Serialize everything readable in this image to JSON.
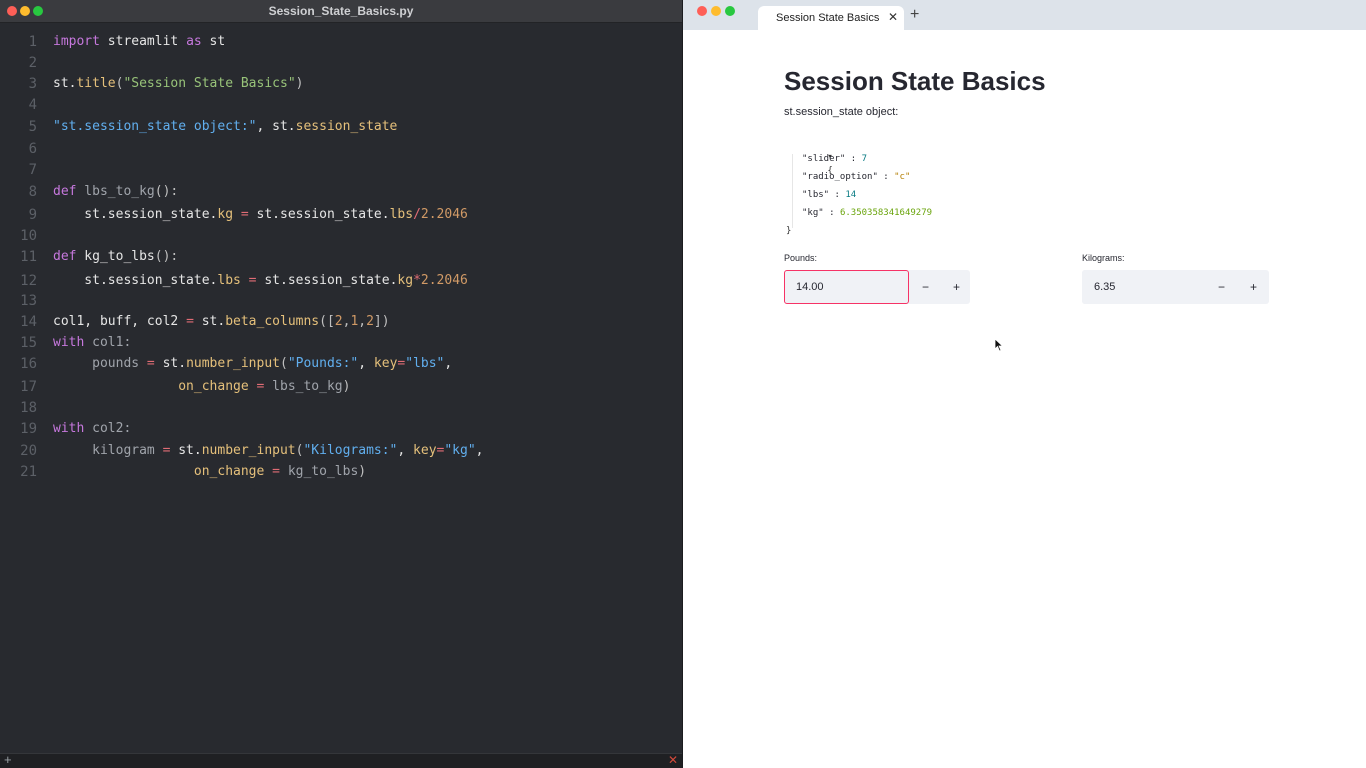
{
  "editor": {
    "title": "Session_State_Basics.py",
    "code": [
      {
        "n": "1",
        "tokens": [
          [
            "kw",
            "import"
          ],
          [
            "var",
            " streamlit "
          ],
          [
            "kw",
            "as"
          ],
          [
            "var",
            " st"
          ]
        ]
      },
      {
        "n": "2",
        "tokens": []
      },
      {
        "n": "3",
        "tokens": [
          [
            "var",
            "st."
          ],
          [
            "fn",
            "title"
          ],
          [
            "par",
            "("
          ],
          [
            "st",
            "\"Session State Basics\""
          ],
          [
            "par",
            ")"
          ]
        ]
      },
      {
        "n": "4",
        "tokens": []
      },
      {
        "n": "5",
        "tokens": [
          [
            "str2",
            "\"st.session_state object:\""
          ],
          [
            "var",
            ", st."
          ],
          [
            "fn",
            "session_state"
          ]
        ]
      },
      {
        "n": "6",
        "tokens": []
      },
      {
        "n": "7",
        "tokens": []
      },
      {
        "n": "8",
        "tokens": [
          [
            "kw",
            "def"
          ],
          [
            "dim",
            " lbs_to_kg"
          ],
          [
            "par",
            "():"
          ]
        ]
      },
      {
        "n": "9",
        "tokens": [
          [
            "var",
            "    st.session_state."
          ],
          [
            "fn",
            "kg"
          ],
          [
            "op",
            " = "
          ],
          [
            "var",
            "st.session_state."
          ],
          [
            "fn",
            "lbs"
          ],
          [
            "op",
            "/"
          ],
          [
            "num",
            "2.2046"
          ]
        ]
      },
      {
        "n": "10",
        "tokens": []
      },
      {
        "n": "11",
        "tokens": [
          [
            "kw",
            "def"
          ],
          [
            "var",
            " kg_to_lbs"
          ],
          [
            "par",
            "():"
          ]
        ]
      },
      {
        "n": "12",
        "tokens": [
          [
            "var",
            "    st.session_state."
          ],
          [
            "fn",
            "lbs"
          ],
          [
            "op",
            " = "
          ],
          [
            "var",
            "st.session_state."
          ],
          [
            "fn",
            "kg"
          ],
          [
            "op",
            "*"
          ],
          [
            "num",
            "2.2046"
          ]
        ]
      },
      {
        "n": "13",
        "tokens": []
      },
      {
        "n": "14",
        "tokens": [
          [
            "var",
            "col1, buff, col2 "
          ],
          [
            "op",
            "="
          ],
          [
            "var",
            " st."
          ],
          [
            "fn",
            "beta_columns"
          ],
          [
            "par",
            "(["
          ],
          [
            "num",
            "2"
          ],
          [
            "par",
            ","
          ],
          [
            "num",
            "1"
          ],
          [
            "par",
            ","
          ],
          [
            "num",
            "2"
          ],
          [
            "par",
            "])"
          ]
        ]
      },
      {
        "n": "15",
        "tokens": [
          [
            "kw",
            "with"
          ],
          [
            "dim",
            " col1:"
          ]
        ]
      },
      {
        "n": "16",
        "tokens": [
          [
            "dim",
            "     pounds "
          ],
          [
            "op",
            "="
          ],
          [
            "var",
            " st."
          ],
          [
            "fn",
            "number_input"
          ],
          [
            "par",
            "("
          ],
          [
            "str2",
            "\"Pounds:\""
          ],
          [
            "var",
            ", "
          ],
          [
            "fn",
            "key"
          ],
          [
            "op",
            "="
          ],
          [
            "str2",
            "\"lbs\""
          ],
          [
            "var",
            ","
          ]
        ]
      },
      {
        "n": "17",
        "tokens": [
          [
            "var",
            "                "
          ],
          [
            "fn",
            "on_change"
          ],
          [
            "op",
            " = "
          ],
          [
            "dim",
            "lbs_to_kg"
          ],
          [
            "par",
            ")"
          ]
        ]
      },
      {
        "n": "18",
        "tokens": []
      },
      {
        "n": "19",
        "tokens": [
          [
            "kw",
            "with"
          ],
          [
            "dim",
            " col2:"
          ]
        ]
      },
      {
        "n": "20",
        "tokens": [
          [
            "dim",
            "     kilogram "
          ],
          [
            "op",
            "="
          ],
          [
            "var",
            " st."
          ],
          [
            "fn",
            "number_input"
          ],
          [
            "par",
            "("
          ],
          [
            "str2",
            "\"Kilograms:\""
          ],
          [
            "var",
            ", "
          ],
          [
            "fn",
            "key"
          ],
          [
            "op",
            "="
          ],
          [
            "str2",
            "\"kg\""
          ],
          [
            "var",
            ","
          ]
        ]
      },
      {
        "n": "21",
        "tokens": [
          [
            "var",
            "                  "
          ],
          [
            "fn",
            "on_change"
          ],
          [
            "op",
            " = "
          ],
          [
            "dim",
            "kg_to_lbs"
          ],
          [
            "par",
            ")"
          ]
        ]
      }
    ],
    "status_plus": "+",
    "status_close": "✕"
  },
  "browser": {
    "tab_title": "Session State Basics",
    "tab_close": "✕",
    "new_tab": "+"
  },
  "app": {
    "title": "Session State Basics",
    "object_label": "st.session_state object:",
    "json": {
      "toggle": "▾",
      "open": "{",
      "close": "}",
      "entries": [
        {
          "key": "\"slider\"",
          "value": "7",
          "type": "jnum"
        },
        {
          "key": "\"radio_option\"",
          "value": "\"c\"",
          "type": "jstr"
        },
        {
          "key": "\"lbs\"",
          "value": "14",
          "type": "jnum"
        },
        {
          "key": "\"kg\"",
          "value": "6.350358341649279",
          "type": "jflt"
        }
      ]
    },
    "pounds": {
      "label": "Pounds:",
      "value": "14.00",
      "minus": "−",
      "plus": "+"
    },
    "kilograms": {
      "label": "Kilograms:",
      "value": "6.35",
      "minus": "−",
      "plus": "+"
    }
  }
}
